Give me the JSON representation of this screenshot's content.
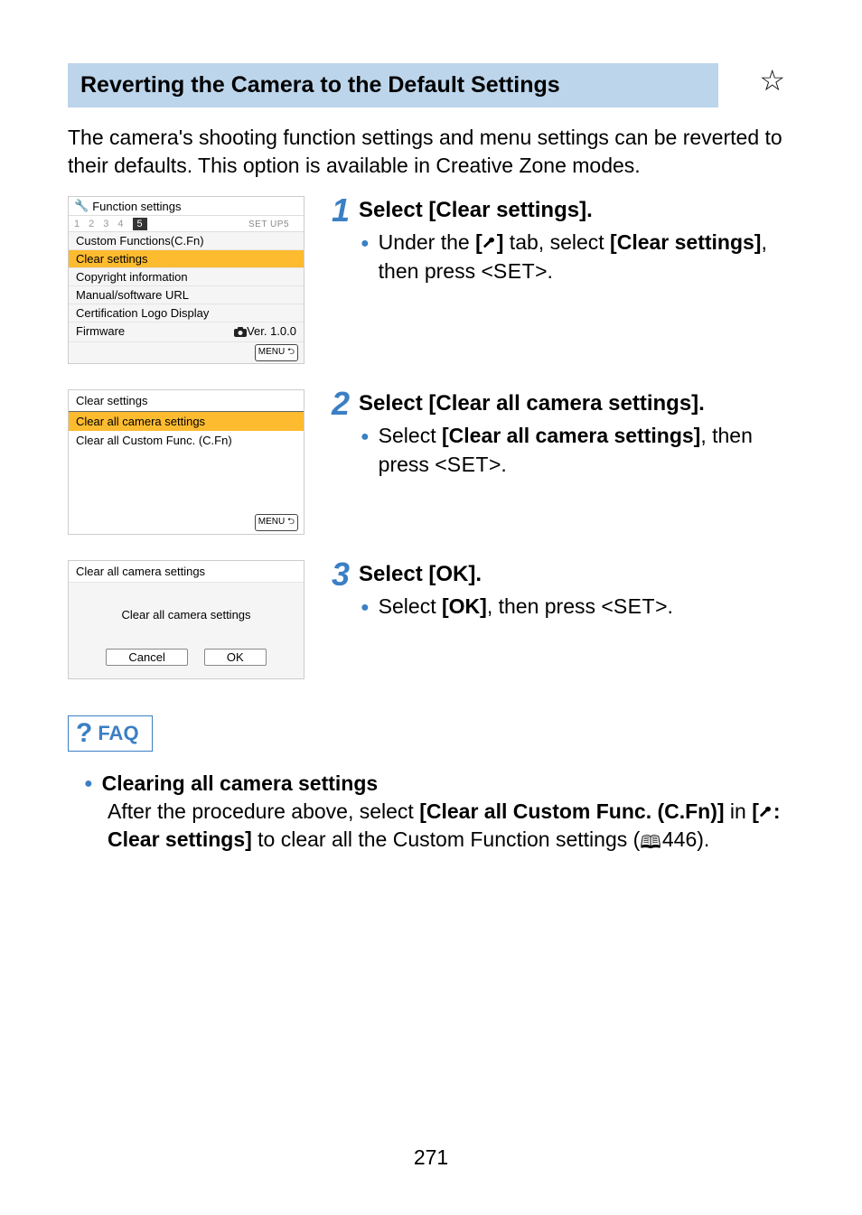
{
  "page": {
    "title": "Reverting the Camera to the Default Settings",
    "intro": "The camera's shooting function settings and menu settings can be reverted to their defaults. This option is available in Creative Zone modes.",
    "number": "271"
  },
  "steps": [
    {
      "num": "1",
      "heading": "Select [Clear settings].",
      "bullet_pre": "Under the ",
      "bullet_bold1": "[",
      "bullet_bold1b": "]",
      "bullet_mid": " tab, select ",
      "bullet_bold2": "[Clear settings]",
      "bullet_post": ", then press <",
      "bullet_key": "SET",
      "bullet_end": ">."
    },
    {
      "num": "2",
      "heading": "Select [Clear all camera settings].",
      "bullet_pre": "Select ",
      "bullet_bold": "[Clear all camera settings]",
      "bullet_post": ", then press <",
      "bullet_key": "SET",
      "bullet_end": ">."
    },
    {
      "num": "3",
      "heading": "Select [OK].",
      "bullet_pre": "Select ",
      "bullet_bold": "[OK]",
      "bullet_post": ", then press <",
      "bullet_key": "SET",
      "bullet_end": ">."
    }
  ],
  "camera_menu": {
    "header": "Function settings",
    "tabs": [
      "1",
      "2",
      "3",
      "4",
      "5"
    ],
    "setup_label": "SET UP5",
    "items": [
      "Custom Functions(C.Fn)",
      "Clear settings",
      "Copyright information",
      "Manual/software URL",
      "Certification Logo Display"
    ],
    "firmware_label": "Firmware",
    "firmware_version": "Ver. 1.0.0",
    "menu_badge": "MENU"
  },
  "clear_settings_menu": {
    "title": "Clear settings",
    "items": [
      "Clear all camera settings",
      "Clear all Custom Func. (C.Fn)"
    ],
    "menu_badge": "MENU"
  },
  "confirm_dialog": {
    "title": "Clear all camera settings",
    "message": "Clear all camera settings",
    "cancel": "Cancel",
    "ok": "OK"
  },
  "faq": {
    "label": "FAQ",
    "item_title": "Clearing all camera settings",
    "body_pre": "After the procedure above, select ",
    "body_bold1": "[Clear all Custom Func. (C.Fn)]",
    "body_mid1": " in ",
    "body_bold2a": "[",
    "body_bold2b": ": Clear settings]",
    "body_post": " to clear all the Custom Function settings (",
    "page_ref": "446",
    "body_end": ")."
  }
}
